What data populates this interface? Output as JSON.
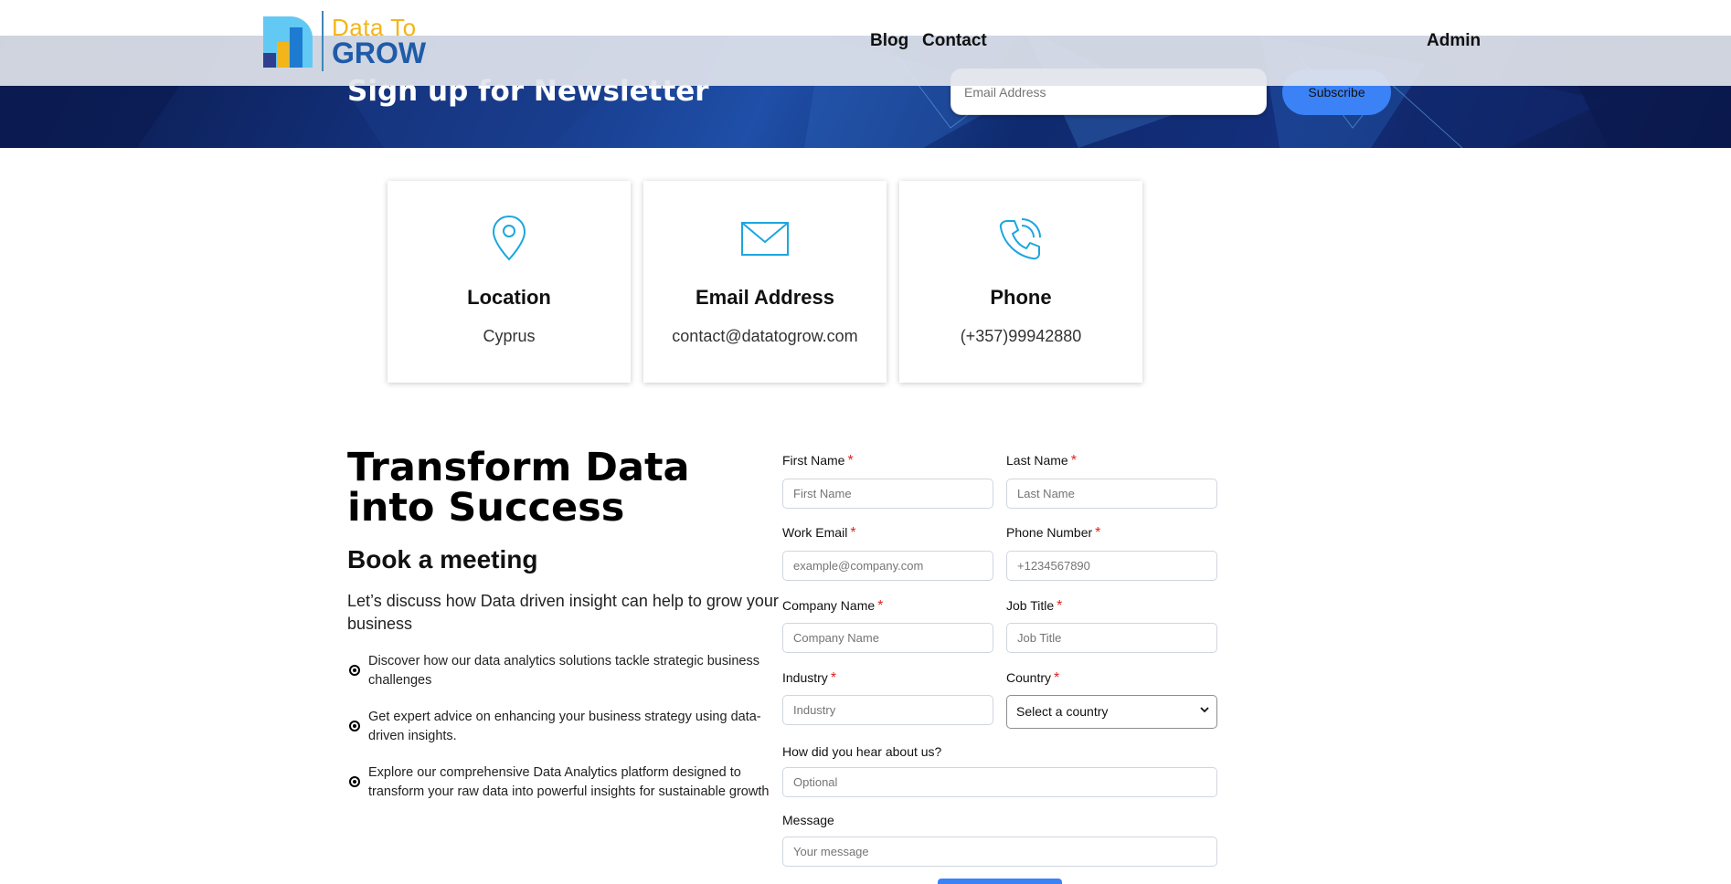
{
  "nav": {
    "logo_line1": "Data To",
    "logo_line2": "GROW",
    "links": [
      "Blog",
      "Contact"
    ],
    "admin": "Admin"
  },
  "newsletter": {
    "title": "Sign up for Newsletter",
    "placeholder": "Email Address",
    "button": "Subscribe"
  },
  "cards": [
    {
      "icon": "location-pin-icon",
      "title": "Location",
      "value": "Cyprus"
    },
    {
      "icon": "envelope-icon",
      "title": "Email Address",
      "value": "contact@datatogrow.com"
    },
    {
      "icon": "phone-icon",
      "title": "Phone",
      "value": "(+357)99942880"
    }
  ],
  "intro": {
    "headline": "Transform Data into Success",
    "subhead": "Book a meeting",
    "lead": "Let’s discuss how Data driven insight can help to grow your business",
    "bullets": [
      "Discover how our data analytics solutions tackle strategic business challenges",
      "Get expert advice on enhancing your business strategy using data-driven insights.",
      "Explore our comprehensive Data Analytics platform designed to transform your raw data into powerful insights for sustainable growth"
    ]
  },
  "form": {
    "required_mark": "*",
    "first_name": {
      "label": "First Name",
      "placeholder": "First Name"
    },
    "last_name": {
      "label": "Last Name",
      "placeholder": "Last Name"
    },
    "work_email": {
      "label": "Work Email",
      "placeholder": "example@company.com"
    },
    "phone": {
      "label": "Phone Number",
      "placeholder": "+1234567890"
    },
    "company": {
      "label": "Company Name",
      "placeholder": "Company Name"
    },
    "job_title": {
      "label": "Job Title",
      "placeholder": "Job Title"
    },
    "industry": {
      "label": "Industry",
      "placeholder": "Industry"
    },
    "country": {
      "label": "Country",
      "selected": "Select a country"
    },
    "hear_about": {
      "label": "How did you hear about us?",
      "placeholder": "Optional"
    },
    "message": {
      "label": "Message",
      "placeholder": "Your message"
    }
  },
  "colors": {
    "accent": "#3b82f6",
    "icon": "#1ba6e0",
    "required": "#dd2222",
    "logo_yellow": "#f3b51a",
    "logo_blue": "#1f5ba8"
  }
}
